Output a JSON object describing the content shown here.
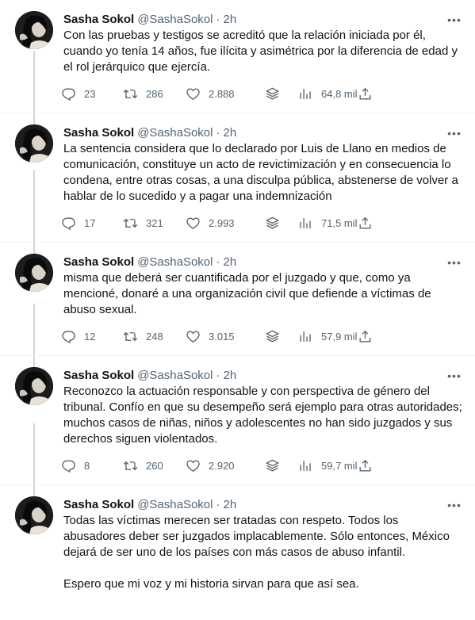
{
  "tweets": [
    {
      "name": "Sasha Sokol",
      "handle": "@SashaSokol",
      "separator": "·",
      "time": "2h",
      "text": "Con las pruebas y testigos se acreditó que la relación iniciada por él, cuando yo tenía 14 años, fue ilícita y asimétrica por la diferencia de edad y el rol jerárquico que ejercía.",
      "replies": "23",
      "retweets": "286",
      "likes": "2.888",
      "views": "64,8 mil"
    },
    {
      "name": "Sasha Sokol",
      "handle": "@SashaSokol",
      "separator": "·",
      "time": "2h",
      "text": "La sentencia considera que lo declarado por Luis de Llano en medios de comunicación, constituye un acto de revictimización y en consecuencia lo condena, entre otras cosas, a una disculpa pública, abstenerse de volver a hablar de lo sucedido y a pagar una indemnización",
      "replies": "17",
      "retweets": "321",
      "likes": "2.993",
      "views": "71,5 mil"
    },
    {
      "name": "Sasha Sokol",
      "handle": "@SashaSokol",
      "separator": "·",
      "time": "2h",
      "text": "misma que deberá ser cuantificada por el juzgado y que, como ya mencioné, donaré a una organización civil que defiende a víctimas de abuso sexual.",
      "replies": "12",
      "retweets": "248",
      "likes": "3.015",
      "views": "57,9 mil"
    },
    {
      "name": "Sasha Sokol",
      "handle": "@SashaSokol",
      "separator": "·",
      "time": "2h",
      "text": "Reconozco la actuación responsable y con perspectiva de género del tribunal. Confío en que su desempeño será ejemplo para otras autoridades; muchos casos de niñas, niños y adolescentes no han sido juzgados y sus derechos siguen violentados.",
      "replies": "8",
      "retweets": "260",
      "likes": "2.920",
      "views": "59,7 mil"
    },
    {
      "name": "Sasha Sokol",
      "handle": "@SashaSokol",
      "separator": "·",
      "time": "2h",
      "text": "Todas las víctimas merecen ser tratadas con respeto. Todos los abusadores deber ser juzgados implacablemente. Sólo entonces, México dejará de ser uno de los países con más casos de abuso infantil.\n\nEspero que mi voz y mi historia sirvan para que así sea.",
      "replies": "",
      "retweets": "",
      "likes": "",
      "views": ""
    }
  ],
  "icons": {
    "more": "more-icon",
    "reply": "reply-icon",
    "retweet": "retweet-icon",
    "like": "heart-icon",
    "bookmark": "stack-icon",
    "views": "views-icon",
    "share": "share-icon"
  },
  "colors": {
    "text": "#0f1419",
    "secondary": "#536471",
    "thread_line": "#cfd9de",
    "divider": "#eff3f4"
  }
}
